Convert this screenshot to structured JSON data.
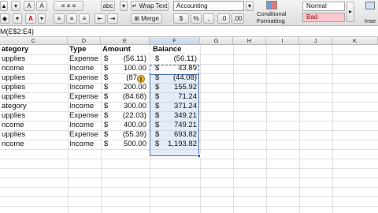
{
  "ribbon": {
    "wrap_text_label": "Wrap Text",
    "merge_label": "Merge",
    "number_format": "Accounting",
    "conditional_formatting_line1": "Conditional",
    "conditional_formatting_line2": "Formatting",
    "style_normal": "Normal",
    "style_bad": "Bad",
    "insert_label": "Inse",
    "abc_label": "abc",
    "percent_label": "%",
    "comma_label": ",",
    "text_color": "#c00000",
    "bad_style_bg": "#ffc7ce",
    "bad_style_text": "#9c0006"
  },
  "formula_bar": {
    "content": "M(E$2:E4)"
  },
  "columns": [
    "C",
    "D",
    "E",
    "F",
    "G",
    "H",
    "I",
    "J",
    "K"
  ],
  "sheet": {
    "headers": {
      "category": "ategory",
      "type": "Type",
      "amount": "Amount",
      "balance": "Balance"
    },
    "currency_symbol": "$",
    "rows": [
      {
        "category": "upplies",
        "type": "Expense",
        "amount": "(56.11)",
        "balance": "(56.11)"
      },
      {
        "category": "ncome",
        "type": "Income",
        "amount": "100.00",
        "balance": "43.89"
      },
      {
        "category": "upplies",
        "type": "Expense",
        "amount": "(87",
        "balance": "(44.08)"
      },
      {
        "category": "upplies",
        "type": "Income",
        "amount": "200.00",
        "balance": "155.92"
      },
      {
        "category": "upplies",
        "type": "Expense",
        "amount": "(84.68)",
        "balance": "71.24"
      },
      {
        "category": "ategory",
        "type": "Income",
        "amount": "300.00",
        "balance": "371.24"
      },
      {
        "category": "upplies",
        "type": "Expense",
        "amount": "(22.03)",
        "balance": "349.21"
      },
      {
        "category": "ncome",
        "type": "Income",
        "amount": "400.00",
        "balance": "749.21"
      },
      {
        "category": "upplies",
        "type": "Expense",
        "amount": "(55.39)",
        "balance": "693.82"
      },
      {
        "category": "ncome",
        "type": "Income",
        "amount": "500.00",
        "balance": "1,193.82"
      }
    ]
  }
}
